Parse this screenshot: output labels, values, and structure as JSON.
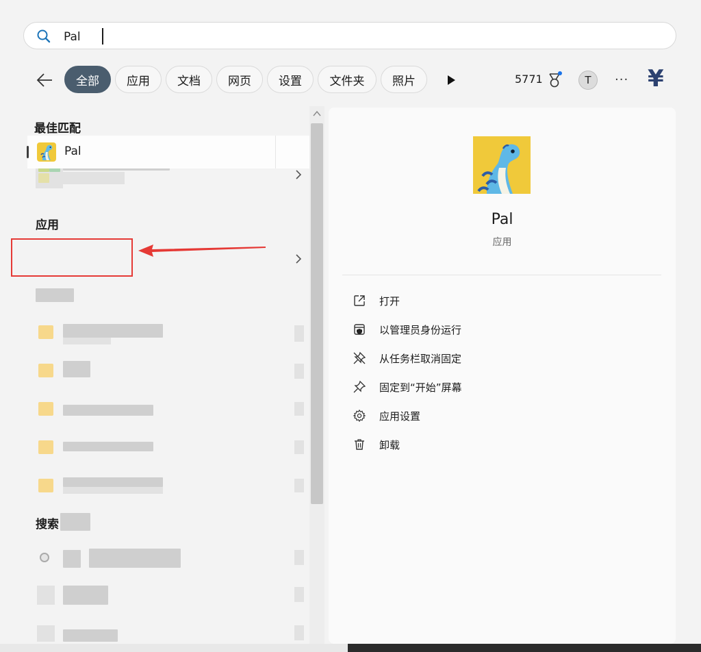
{
  "search": {
    "value": "Pal",
    "placeholder": ""
  },
  "filters": [
    {
      "label": "全部",
      "active": true
    },
    {
      "label": "应用"
    },
    {
      "label": "文档"
    },
    {
      "label": "网页"
    },
    {
      "label": "设置"
    },
    {
      "label": "文件夹"
    },
    {
      "label": "照片"
    }
  ],
  "header": {
    "points": "5771",
    "avatar_initial": "T",
    "more": "···",
    "yen": "¥"
  },
  "sections": {
    "best_match": "最佳匹配",
    "apps": "应用",
    "search": "搜索"
  },
  "app_result": {
    "name": "Pal"
  },
  "detail": {
    "app_name": "Pal",
    "app_type": "应用",
    "actions": [
      {
        "label": "打开",
        "icon": "open-external-icon"
      },
      {
        "label": "以管理员身份运行",
        "icon": "shield-icon"
      },
      {
        "label": "从任务栏取消固定",
        "icon": "unpin-icon"
      },
      {
        "label": "固定到“开始”屏幕",
        "icon": "pin-icon"
      },
      {
        "label": "应用设置",
        "icon": "gear-icon"
      },
      {
        "label": "卸载",
        "icon": "trash-icon"
      }
    ]
  },
  "colors": {
    "accent": "#4a5d6e",
    "annotation": "#e53935",
    "folder": "#f7d88b"
  }
}
